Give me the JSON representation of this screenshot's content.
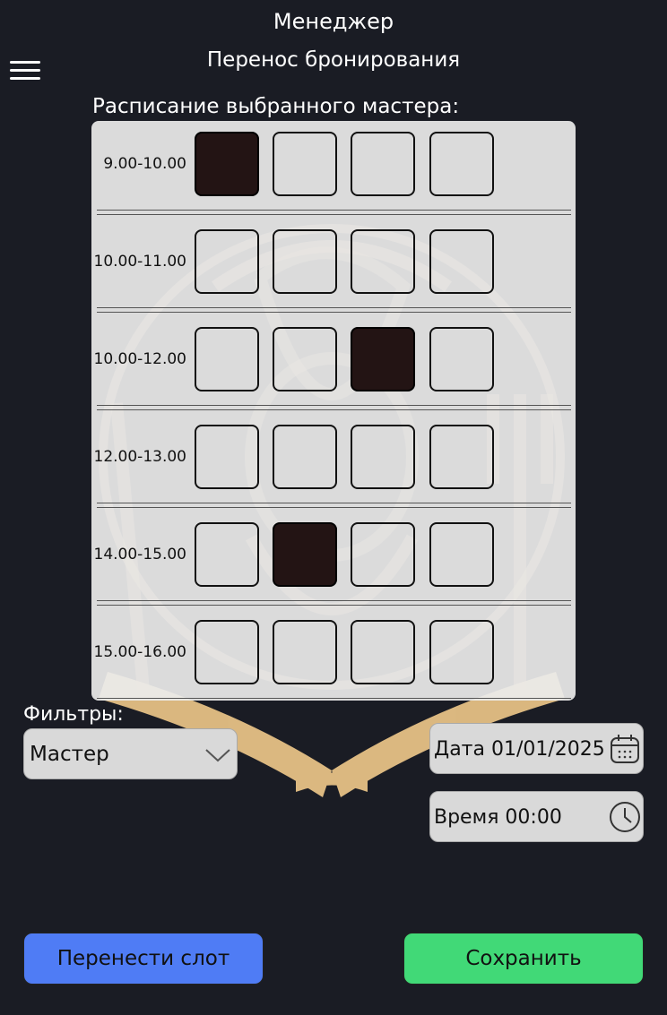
{
  "header": {
    "role": "Менеджер",
    "title": "Перенос бронирования"
  },
  "schedule": {
    "label": "Расписание выбранного мастера:",
    "rows": [
      {
        "time": "9.00-10.00",
        "slots": [
          true,
          false,
          false,
          false
        ]
      },
      {
        "time": "10.00-11.00",
        "slots": [
          false,
          false,
          false,
          false
        ]
      },
      {
        "time": "10.00-12.00",
        "slots": [
          false,
          false,
          true,
          false
        ]
      },
      {
        "time": "12.00-13.00",
        "slots": [
          false,
          false,
          false,
          false
        ]
      },
      {
        "time": "14.00-15.00",
        "slots": [
          false,
          true,
          false,
          false
        ]
      },
      {
        "time": "15.00-16.00",
        "slots": [
          false,
          false,
          false,
          false
        ]
      }
    ]
  },
  "filters": {
    "label": "Фильтры:",
    "master_value": "Мастер",
    "date_value": "Дата 01/01/2025",
    "time_value": "Время 00:00"
  },
  "actions": {
    "move_label": "Перенести  слот",
    "save_label": "Сохранить"
  },
  "colors": {
    "background": "#1a1c24",
    "booked": "#231414",
    "move": "#4f7cf5",
    "save": "#41d977",
    "watermark": "#f0c98a"
  },
  "icons": {
    "menu": "hamburger-icon",
    "dropdown": "chevron-down-icon",
    "date": "calendar-icon",
    "time": "clock-icon"
  }
}
